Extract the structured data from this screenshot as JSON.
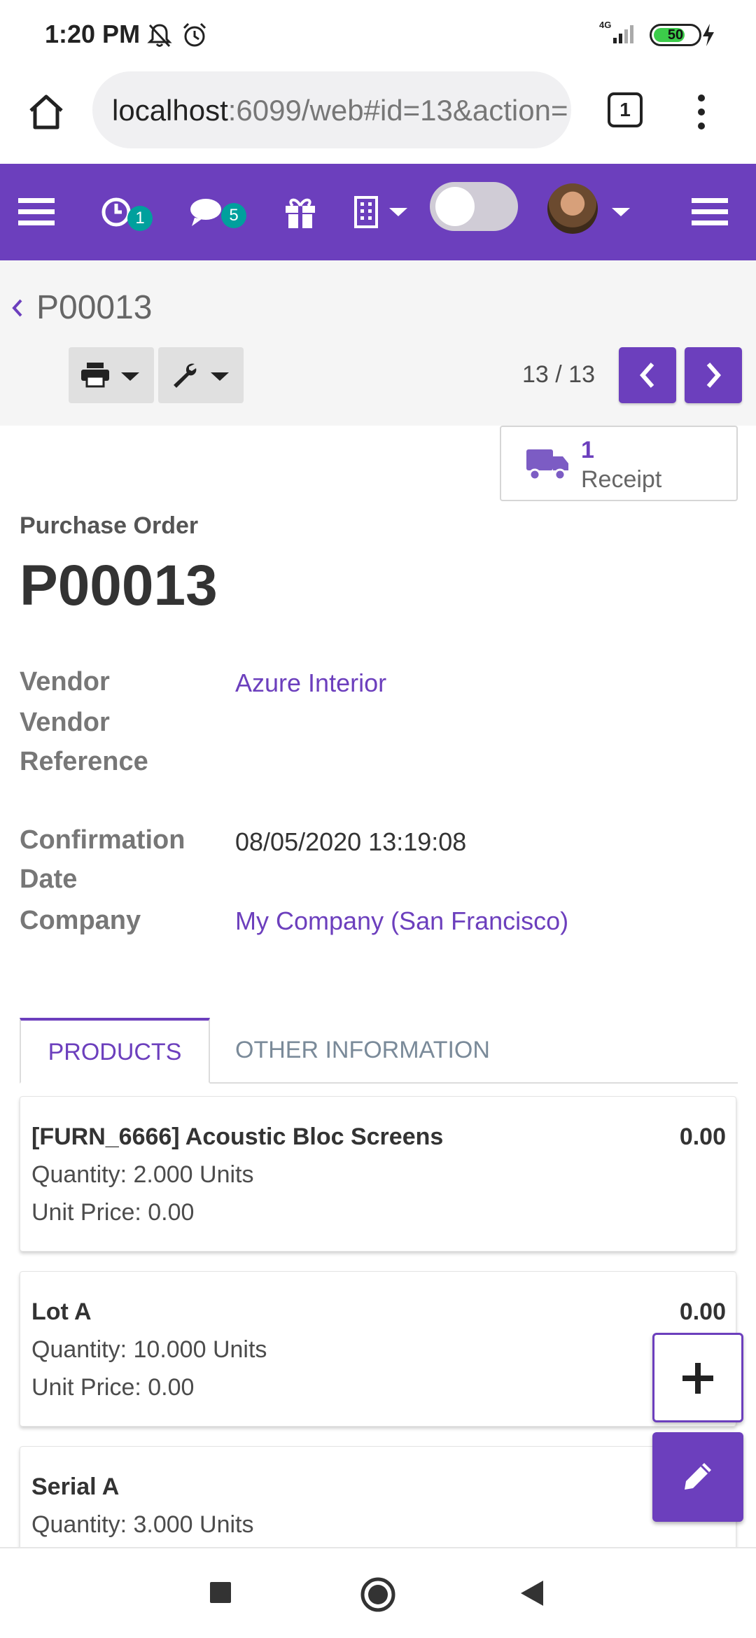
{
  "status_bar": {
    "time": "1:20 PM",
    "network": "4G",
    "battery": "50"
  },
  "browser": {
    "url_host": "localhost",
    "url_rest": ":6099/web#id=13&action=",
    "tab_count": "1"
  },
  "navbar": {
    "activity_badge": "1",
    "messages_badge": "5"
  },
  "breadcrumb": {
    "record": "P00013"
  },
  "pager": {
    "value": "13 / 13"
  },
  "smart_button": {
    "count": "1",
    "label": "Receipt"
  },
  "form": {
    "doc_type": "Purchase Order",
    "name": "P00013",
    "vendor_label": "Vendor",
    "vendor": "Azure Interior",
    "vendor_ref_label_1": "Vendor",
    "vendor_ref_label_2": "Reference",
    "confirm_label_1": "Confirmation",
    "confirm_label_2": "Date",
    "confirm_date": "08/05/2020 13:19:08",
    "company_label": "Company",
    "company": "My Company (San Francisco)"
  },
  "tabs": {
    "products": "PRODUCTS",
    "other": "OTHER INFORMATION"
  },
  "lines": [
    {
      "name": "[FURN_6666] Acoustic Bloc Screens",
      "price": "0.00",
      "qty": "Quantity: 2.000 Units",
      "unit_price": "Unit Price: 0.00"
    },
    {
      "name": "Lot A",
      "price": "0.00",
      "qty": "Quantity: 10.000 Units",
      "unit_price": "Unit Price: 0.00"
    },
    {
      "name": "Serial A",
      "qty": "Quantity: 3.000 Units"
    }
  ],
  "colors": {
    "primary": "#6c3fbd",
    "badge": "#00a09d"
  }
}
